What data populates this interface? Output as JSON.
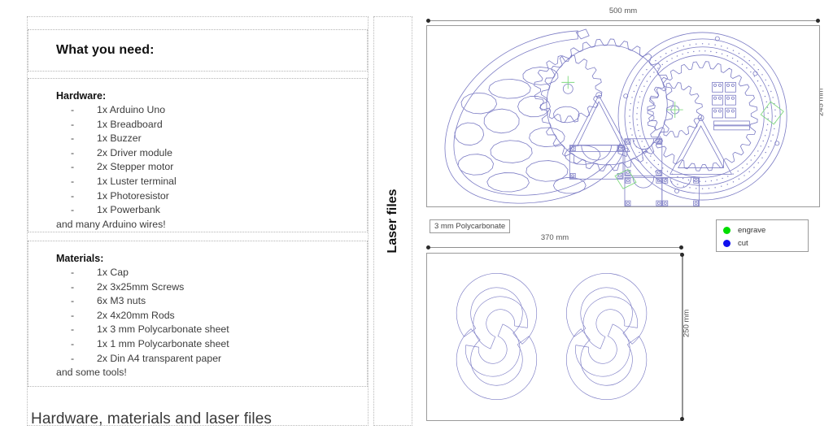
{
  "slide": {
    "title": "Hardware, materials and laser files"
  },
  "need_box": {
    "heading": "What you need:"
  },
  "hardware": {
    "section_title": "Hardware:",
    "bullet": "-",
    "items": [
      "1x Arduino Uno",
      "1x Breadboard",
      "1x Buzzer",
      "2x Driver module",
      "2x Stepper motor",
      "1x Luster terminal",
      "1x Photoresistor",
      "1x Powerbank"
    ],
    "tail": "and many Arduino wires!"
  },
  "materials": {
    "section_title": "Materials:",
    "bullet": "-",
    "items": [
      "1x Cap",
      "2x 3x25mm Screws",
      "6x M3 nuts",
      "2x 4x20mm Rods",
      "1x 3 mm Polycarbonate sheet",
      "1x 1 mm Polycarbonate sheet",
      "2x Din A4 transparent paper"
    ],
    "tail": "and some tools!"
  },
  "laser_column": {
    "label": "Laser files"
  },
  "cad": {
    "dim_top": "500 mm",
    "dim_right": "245 mm",
    "dim_mid": "370  mm",
    "dim_bottom": "250 mm",
    "material_tag": "3 mm Polycarbonate",
    "legend": {
      "items": [
        {
          "label": "engrave",
          "color": "#00dd00"
        },
        {
          "label": "cut",
          "color": "#1010ee"
        }
      ]
    },
    "line_color": "#7b7bc4",
    "engrave_color": "#7fd97f"
  }
}
